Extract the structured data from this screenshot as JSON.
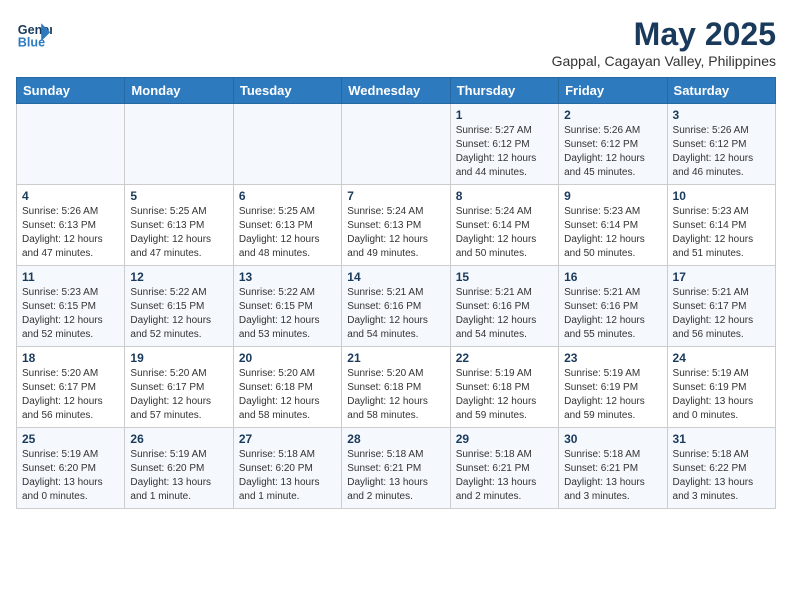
{
  "app": {
    "logo_line1": "General",
    "logo_line2": "Blue"
  },
  "header": {
    "title": "May 2025",
    "subtitle": "Gappal, Cagayan Valley, Philippines"
  },
  "weekdays": [
    "Sunday",
    "Monday",
    "Tuesday",
    "Wednesday",
    "Thursday",
    "Friday",
    "Saturday"
  ],
  "weeks": [
    [
      {
        "day": "",
        "info": ""
      },
      {
        "day": "",
        "info": ""
      },
      {
        "day": "",
        "info": ""
      },
      {
        "day": "",
        "info": ""
      },
      {
        "day": "1",
        "info": "Sunrise: 5:27 AM\nSunset: 6:12 PM\nDaylight: 12 hours\nand 44 minutes."
      },
      {
        "day": "2",
        "info": "Sunrise: 5:26 AM\nSunset: 6:12 PM\nDaylight: 12 hours\nand 45 minutes."
      },
      {
        "day": "3",
        "info": "Sunrise: 5:26 AM\nSunset: 6:12 PM\nDaylight: 12 hours\nand 46 minutes."
      }
    ],
    [
      {
        "day": "4",
        "info": "Sunrise: 5:26 AM\nSunset: 6:13 PM\nDaylight: 12 hours\nand 47 minutes."
      },
      {
        "day": "5",
        "info": "Sunrise: 5:25 AM\nSunset: 6:13 PM\nDaylight: 12 hours\nand 47 minutes."
      },
      {
        "day": "6",
        "info": "Sunrise: 5:25 AM\nSunset: 6:13 PM\nDaylight: 12 hours\nand 48 minutes."
      },
      {
        "day": "7",
        "info": "Sunrise: 5:24 AM\nSunset: 6:13 PM\nDaylight: 12 hours\nand 49 minutes."
      },
      {
        "day": "8",
        "info": "Sunrise: 5:24 AM\nSunset: 6:14 PM\nDaylight: 12 hours\nand 50 minutes."
      },
      {
        "day": "9",
        "info": "Sunrise: 5:23 AM\nSunset: 6:14 PM\nDaylight: 12 hours\nand 50 minutes."
      },
      {
        "day": "10",
        "info": "Sunrise: 5:23 AM\nSunset: 6:14 PM\nDaylight: 12 hours\nand 51 minutes."
      }
    ],
    [
      {
        "day": "11",
        "info": "Sunrise: 5:23 AM\nSunset: 6:15 PM\nDaylight: 12 hours\nand 52 minutes."
      },
      {
        "day": "12",
        "info": "Sunrise: 5:22 AM\nSunset: 6:15 PM\nDaylight: 12 hours\nand 52 minutes."
      },
      {
        "day": "13",
        "info": "Sunrise: 5:22 AM\nSunset: 6:15 PM\nDaylight: 12 hours\nand 53 minutes."
      },
      {
        "day": "14",
        "info": "Sunrise: 5:21 AM\nSunset: 6:16 PM\nDaylight: 12 hours\nand 54 minutes."
      },
      {
        "day": "15",
        "info": "Sunrise: 5:21 AM\nSunset: 6:16 PM\nDaylight: 12 hours\nand 54 minutes."
      },
      {
        "day": "16",
        "info": "Sunrise: 5:21 AM\nSunset: 6:16 PM\nDaylight: 12 hours\nand 55 minutes."
      },
      {
        "day": "17",
        "info": "Sunrise: 5:21 AM\nSunset: 6:17 PM\nDaylight: 12 hours\nand 56 minutes."
      }
    ],
    [
      {
        "day": "18",
        "info": "Sunrise: 5:20 AM\nSunset: 6:17 PM\nDaylight: 12 hours\nand 56 minutes."
      },
      {
        "day": "19",
        "info": "Sunrise: 5:20 AM\nSunset: 6:17 PM\nDaylight: 12 hours\nand 57 minutes."
      },
      {
        "day": "20",
        "info": "Sunrise: 5:20 AM\nSunset: 6:18 PM\nDaylight: 12 hours\nand 58 minutes."
      },
      {
        "day": "21",
        "info": "Sunrise: 5:20 AM\nSunset: 6:18 PM\nDaylight: 12 hours\nand 58 minutes."
      },
      {
        "day": "22",
        "info": "Sunrise: 5:19 AM\nSunset: 6:18 PM\nDaylight: 12 hours\nand 59 minutes."
      },
      {
        "day": "23",
        "info": "Sunrise: 5:19 AM\nSunset: 6:19 PM\nDaylight: 12 hours\nand 59 minutes."
      },
      {
        "day": "24",
        "info": "Sunrise: 5:19 AM\nSunset: 6:19 PM\nDaylight: 13 hours\nand 0 minutes."
      }
    ],
    [
      {
        "day": "25",
        "info": "Sunrise: 5:19 AM\nSunset: 6:20 PM\nDaylight: 13 hours\nand 0 minutes."
      },
      {
        "day": "26",
        "info": "Sunrise: 5:19 AM\nSunset: 6:20 PM\nDaylight: 13 hours\nand 1 minute."
      },
      {
        "day": "27",
        "info": "Sunrise: 5:18 AM\nSunset: 6:20 PM\nDaylight: 13 hours\nand 1 minute."
      },
      {
        "day": "28",
        "info": "Sunrise: 5:18 AM\nSunset: 6:21 PM\nDaylight: 13 hours\nand 2 minutes."
      },
      {
        "day": "29",
        "info": "Sunrise: 5:18 AM\nSunset: 6:21 PM\nDaylight: 13 hours\nand 2 minutes."
      },
      {
        "day": "30",
        "info": "Sunrise: 5:18 AM\nSunset: 6:21 PM\nDaylight: 13 hours\nand 3 minutes."
      },
      {
        "day": "31",
        "info": "Sunrise: 5:18 AM\nSunset: 6:22 PM\nDaylight: 13 hours\nand 3 minutes."
      }
    ]
  ]
}
